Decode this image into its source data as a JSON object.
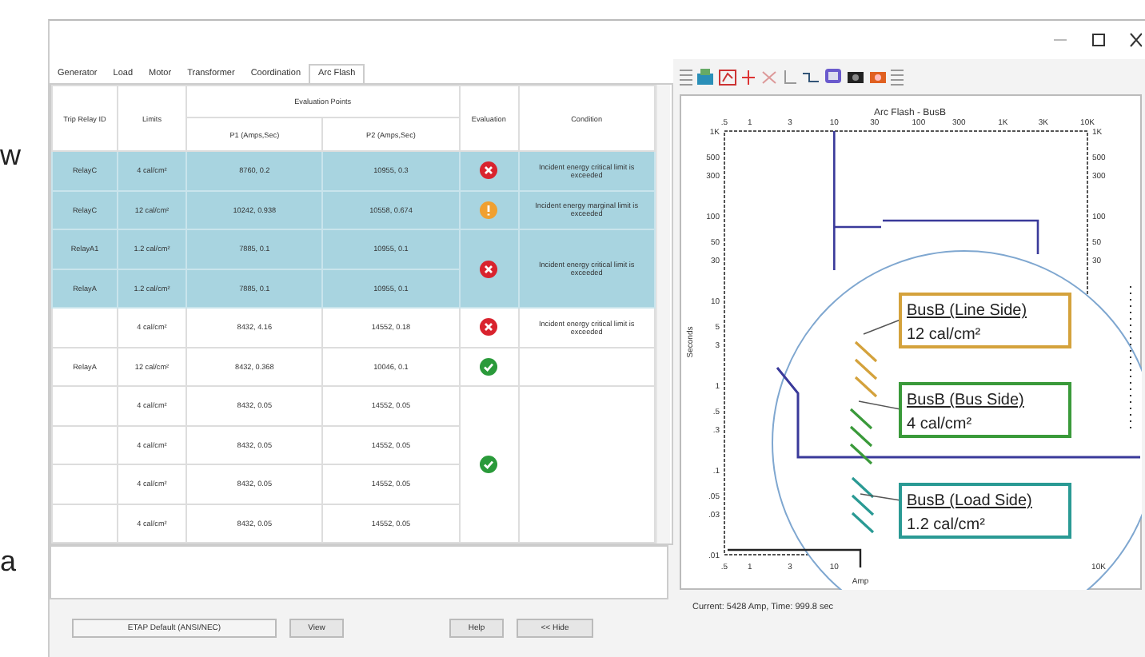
{
  "edge_text": [
    "w",
    "a"
  ],
  "tabs": [
    {
      "label": "Generator",
      "selected": false
    },
    {
      "label": "Load",
      "selected": false
    },
    {
      "label": "Motor",
      "selected": false
    },
    {
      "label": "Transformer",
      "selected": false
    },
    {
      "label": "Coordination",
      "selected": false
    },
    {
      "label": "Arc Flash",
      "selected": true
    }
  ],
  "table": {
    "columns": {
      "relay": "Trip Relay ID",
      "limits": "Limits",
      "points": "Evaluation Points",
      "p1": "P1 (Amps,Sec)",
      "p2": "P2 (Amps,Sec)",
      "evaluation": "Evaluation",
      "condition": "Condition"
    },
    "groups": [
      {
        "selected": true,
        "kind": "error",
        "condition": "Incident energy critical limit is exceeded",
        "rows": [
          {
            "relay": "RelayC",
            "limit": "4 cal/cm²",
            "p1": "8760, 0.2",
            "p2": "10955, 0.3"
          }
        ]
      },
      {
        "selected": true,
        "kind": "warning",
        "condition": "Incident energy marginal limit is exceeded",
        "rows": [
          {
            "relay": "RelayC",
            "limit": "12 cal/cm²",
            "p1": "10242, 0.938",
            "p2": "10558, 0.674"
          }
        ]
      },
      {
        "selected": true,
        "kind": "error",
        "condition": "Incident energy critical limit is exceeded",
        "rows": [
          {
            "relay": "RelayA1",
            "limit": "1.2 cal/cm²",
            "p1": "7885, 0.1",
            "p2": "10955, 0.1"
          },
          {
            "relay": "RelayA",
            "limit": "1.2 cal/cm²",
            "p1": "7885, 0.1",
            "p2": "10955, 0.1"
          }
        ]
      },
      {
        "selected": false,
        "kind": "error",
        "condition": "Incident energy critical limit is exceeded",
        "rows": [
          {
            "limit": "4 cal/cm²",
            "p1": "8432, 4.16",
            "p2": "14552, 0.18"
          }
        ]
      },
      {
        "selected": false,
        "kind": "ok",
        "rows": [
          {
            "relay": "RelayA",
            "limit": "12 cal/cm²",
            "p1": "8432, 0.368",
            "p2": "10046, 0.1"
          }
        ]
      },
      {
        "selected": false,
        "kind": "ok",
        "rows": [
          {
            "limit": "4 cal/cm²",
            "p1": "8432, 0.05",
            "p2": "14552, 0.05"
          },
          {
            "limit": "4 cal/cm²",
            "p1": "8432, 0.05",
            "p2": "14552, 0.05"
          },
          {
            "limit": "4 cal/cm²",
            "p1": "8432, 0.05",
            "p2": "14552, 0.05"
          },
          {
            "limit": "4 cal/cm²",
            "p1": "8432, 0.05",
            "p2": "14552, 0.05"
          }
        ]
      }
    ]
  },
  "bottom": {
    "standard": "ETAP Default (ANSI/NEC)",
    "buttons": [
      "View",
      "Help",
      "<< Hide"
    ]
  },
  "plot": {
    "title": "Arc Flash - BusB",
    "ylabel": "Seconds",
    "xlabel": "Amp",
    "top_x_labels": [
      ".5",
      "1",
      "3",
      "10",
      "30",
      "100",
      "300",
      "1K",
      "3K",
      "10K"
    ],
    "left_y_labels": [
      "1K",
      "500",
      "300",
      "100",
      "50",
      "30",
      "10",
      "5",
      "3",
      "1",
      ".5",
      ".3",
      ".1",
      ".05",
      ".03",
      ".01"
    ],
    "right_y_labels": [
      "1K",
      "500",
      "300",
      "100",
      "50",
      "30"
    ],
    "bottom_x_labels": [
      ".5",
      "1",
      "3",
      "10"
    ],
    "bottom_right_label": "10K",
    "callouts": [
      {
        "title": "BusB (Line Side)",
        "value": "12 cal/cm²",
        "color": "#d4a23c"
      },
      {
        "title": "BusB (Bus Side)",
        "value": "4 cal/cm²",
        "color": "#3a9a3a"
      },
      {
        "title": "BusB (Load Side)",
        "value": "1.2 cal/cm²",
        "color": "#2a9a94"
      }
    ]
  },
  "status": "Current: 5428 Amp,  Time: 999.8 sec"
}
